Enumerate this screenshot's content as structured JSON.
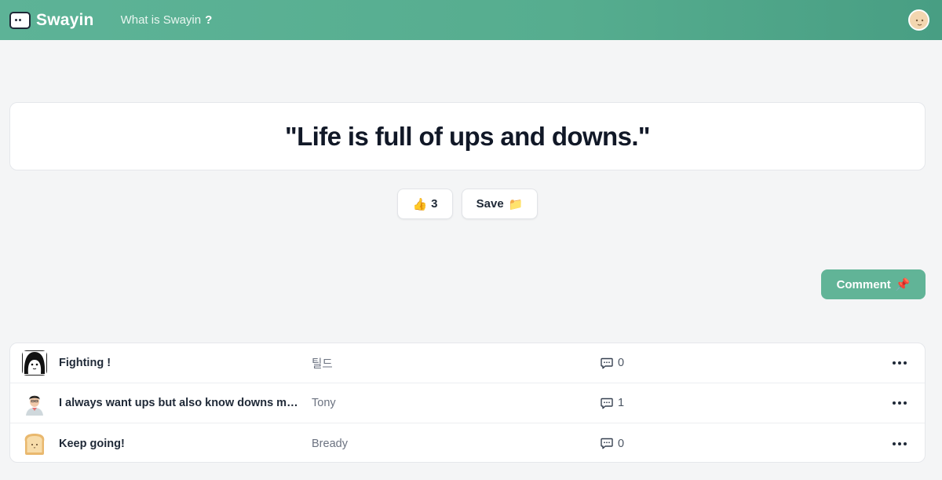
{
  "header": {
    "brand": "Swayin",
    "nav_link": "What is Swayin",
    "nav_icon": "question-mark-icon"
  },
  "quote": {
    "text": "\"Life is full of ups and downs.\""
  },
  "actions": {
    "like_icon": "👍",
    "like_count": "3",
    "save_label": "Save",
    "save_icon": "📁",
    "comment_label": "Comment",
    "comment_icon": "📌"
  },
  "comments": [
    {
      "title": "Fighting !",
      "author": "틸드",
      "replies": "0",
      "avatar": "sketch-face-avatar"
    },
    {
      "title": "I always want ups but also know downs must be there.",
      "author": "Tony",
      "replies": "1",
      "avatar": "person-avatar"
    },
    {
      "title": "Keep going!",
      "author": "Bready",
      "replies": "0",
      "avatar": "bread-avatar"
    }
  ],
  "colors": {
    "header": "#56ad8f",
    "accent": "#61b497",
    "background": "#f4f5f6"
  }
}
